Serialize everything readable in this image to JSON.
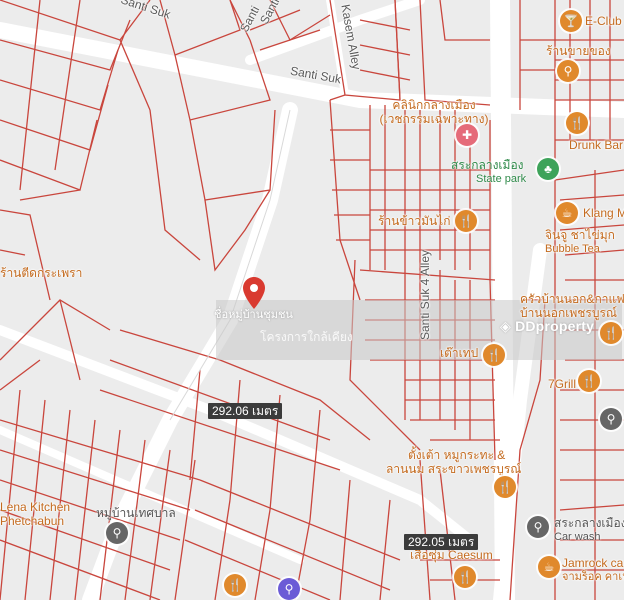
{
  "map": {
    "road_labels": {
      "santi_suk_top": "Santi Suk",
      "santi_suk_2": "Santi",
      "santi_suk_3": "Santi",
      "santi_suk_mid": "Santi Suk",
      "kasem_alley": "Kasem Alley",
      "santi_suk_4_alley": "Santi Suk 4 Alley"
    },
    "pois": {
      "clinic": "คลินิกกลางเมือง (เวชกรรมเฉพาะทาง)",
      "e_club": "E-Club",
      "shop_tr": "ร้านขายของ",
      "drunk_bar": "Drunk Bar &",
      "park_name": "สระกลางเมือง",
      "park_sub": "State park",
      "klang": "Klang M",
      "shop_mid": "ร้านข้าวมันไก่",
      "jin_bubble": "จินจู ชาไข่มุก",
      "bubble_tea": "Bubble Tea",
      "food_left": "ร้านตีดกระเพรา",
      "kitchen_th": "ครัวบ้านนอก&กาแฟ",
      "kitchen_th2": "บ้านนอกเพชรบูรณ์",
      "tao_thep": "เต๊าเทป",
      "seven_grill": "7Grill",
      "tungta": "ตั้งเต้า หมูกระทะ &",
      "tungta2": "ลานนม สระขาวเพชรบูรณ์",
      "village": "หมู่บ้านเทศบาล",
      "kitchen_left": "Lena Kitchen",
      "kitchen_left2": "Phetchabun",
      "caesum": "เสือซุ่ม Caesum",
      "carwash": "สระกลางเมือง",
      "carwash_sub": "Car wash",
      "jamrock": "Jamrock ca",
      "jamrock_sub": "จามร็อค คาเฟ่"
    },
    "distances": {
      "d1": "292.06 เมตร",
      "d2": "292.05 เมตร"
    },
    "marker_label": "ชื่อหมู่บ้านชุมชน",
    "watermark": {
      "brand": "DDproperty",
      "faint": "โครงการใกล้เคียง"
    },
    "colors": {
      "parcel": "#c9463d",
      "background": "#ececec",
      "road": "#ffffff",
      "poi_orange": "#e0892c",
      "park_green": "#3ea35a",
      "marker_red": "#d93a30"
    }
  }
}
